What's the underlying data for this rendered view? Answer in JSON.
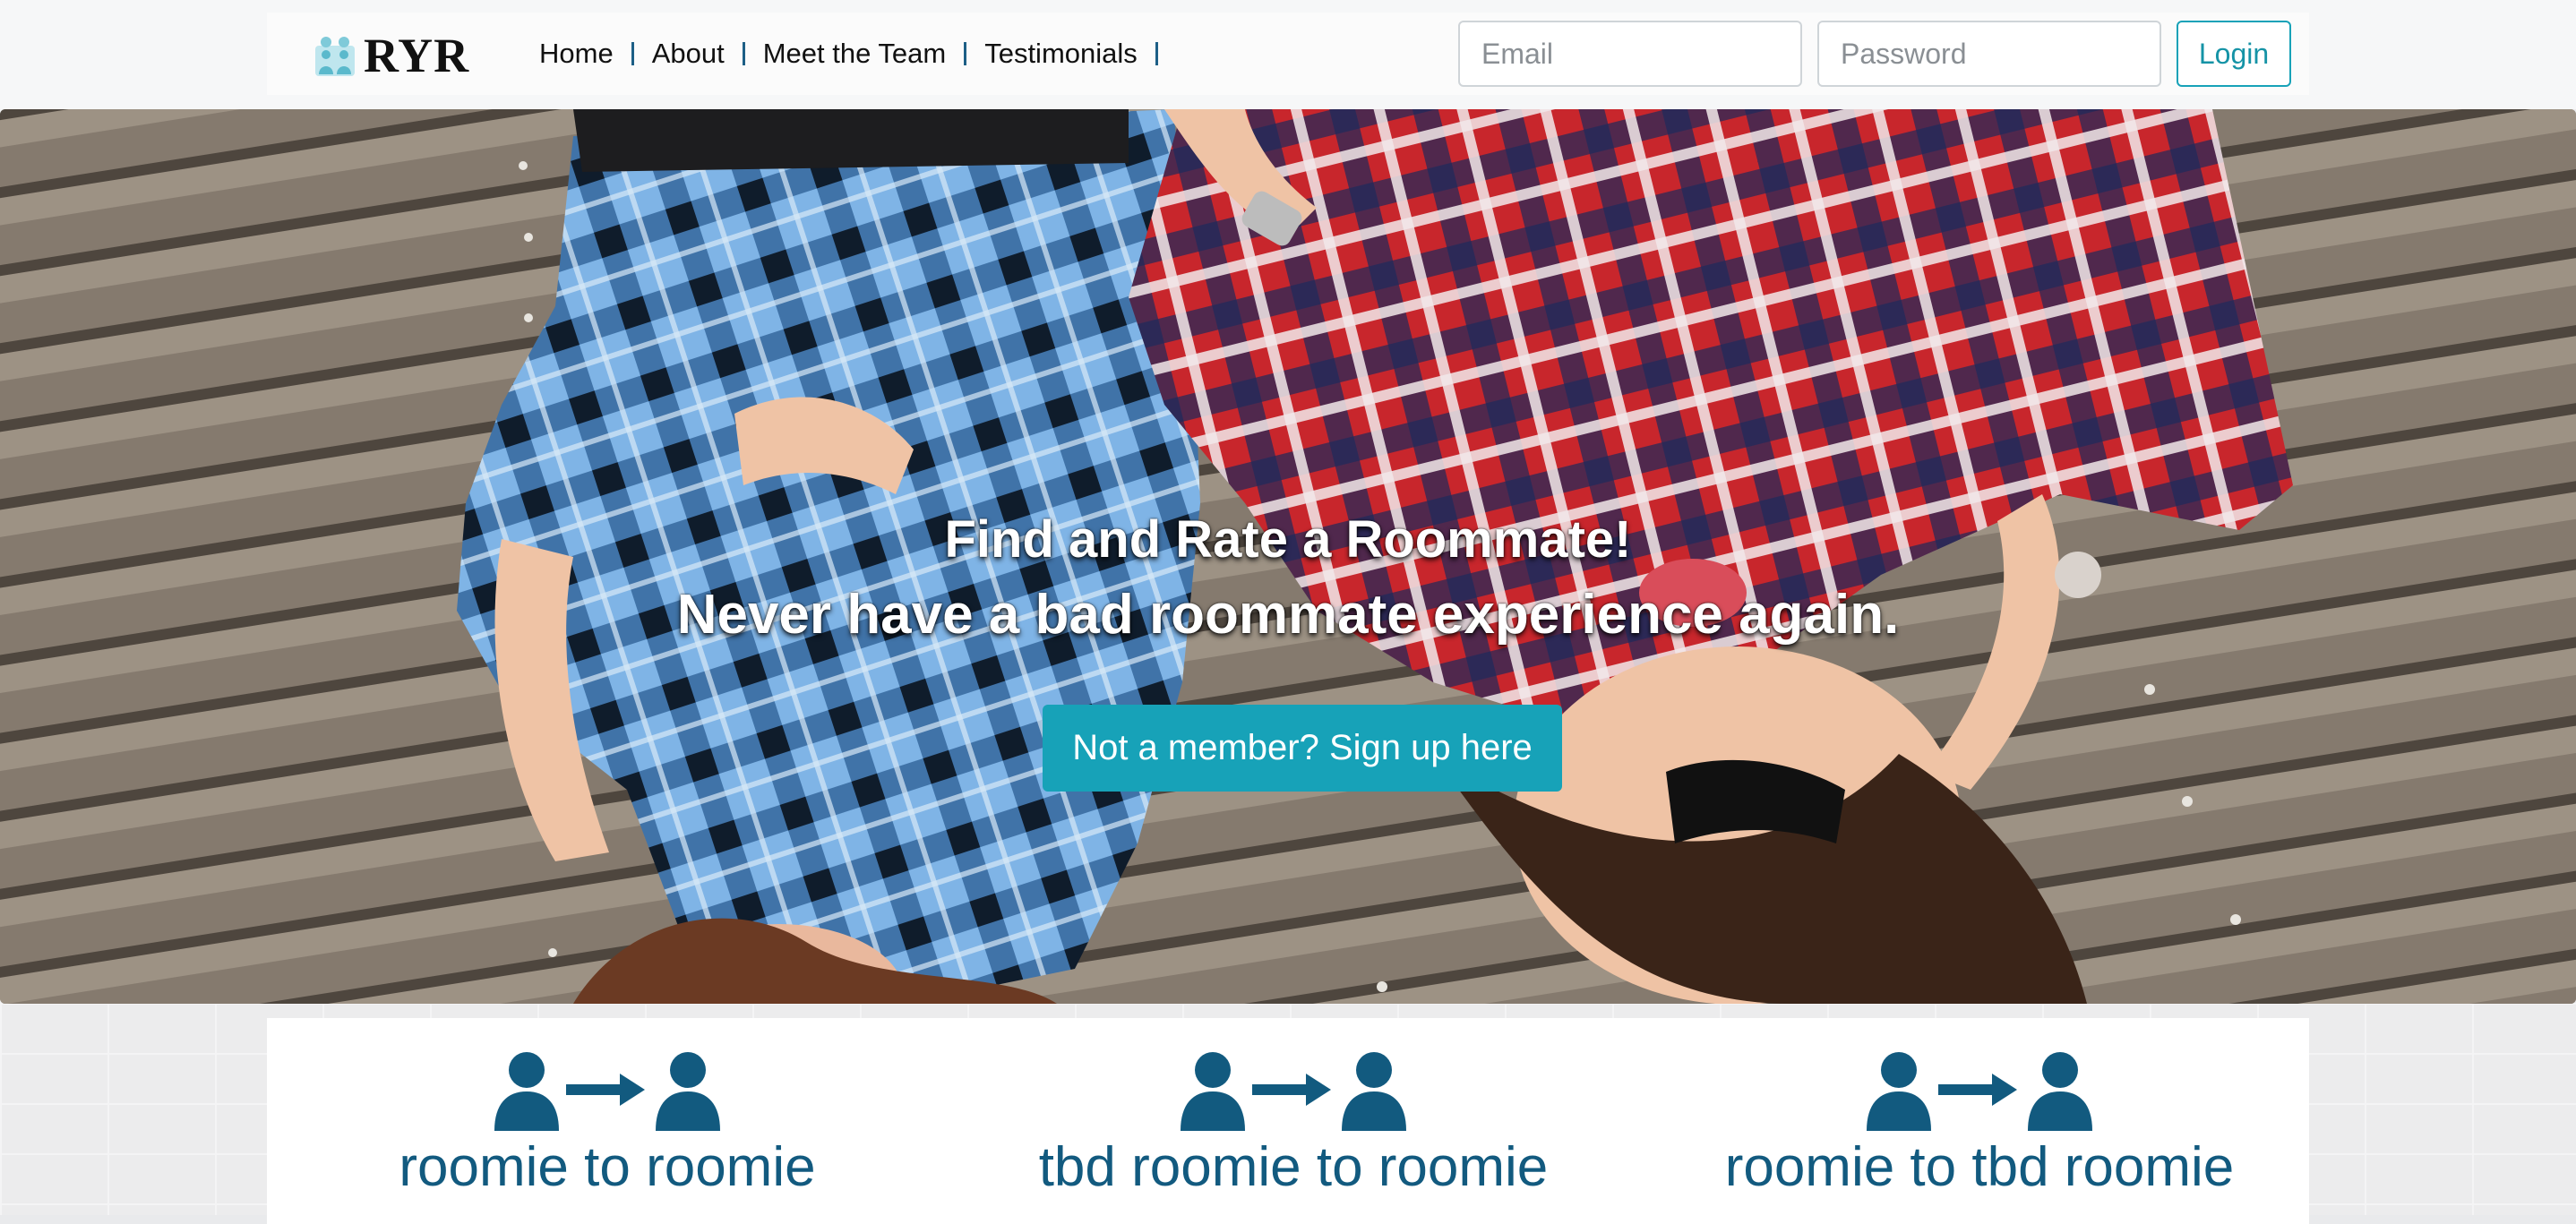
{
  "brand": {
    "name": "RYR",
    "logo_icon": "roommates-logo-icon"
  },
  "nav": {
    "links": [
      {
        "label": "Home"
      },
      {
        "label": "About"
      },
      {
        "label": "Meet the Team"
      },
      {
        "label": "Testimonials"
      }
    ]
  },
  "login": {
    "email_placeholder": "Email",
    "password_placeholder": "Password",
    "login_label": "Login"
  },
  "hero": {
    "headline": "Find and Rate a Roommate!",
    "subheadline": "Never have a bad roommate experience again.",
    "cta_label": "Not a member? Sign up here"
  },
  "features": [
    {
      "title": "roomie to roomie",
      "icon": "person-arrow-person-icon"
    },
    {
      "title": "tbd roomie to roomie",
      "icon": "person-arrow-person-icon"
    },
    {
      "title": "roomie to tbd roomie",
      "icon": "person-arrow-person-icon"
    }
  ],
  "colors": {
    "accent": "#17a2b8",
    "nav_separator": "#1d5f86",
    "feature_blue": "#125a7f",
    "hero_text": "#ffffff"
  }
}
